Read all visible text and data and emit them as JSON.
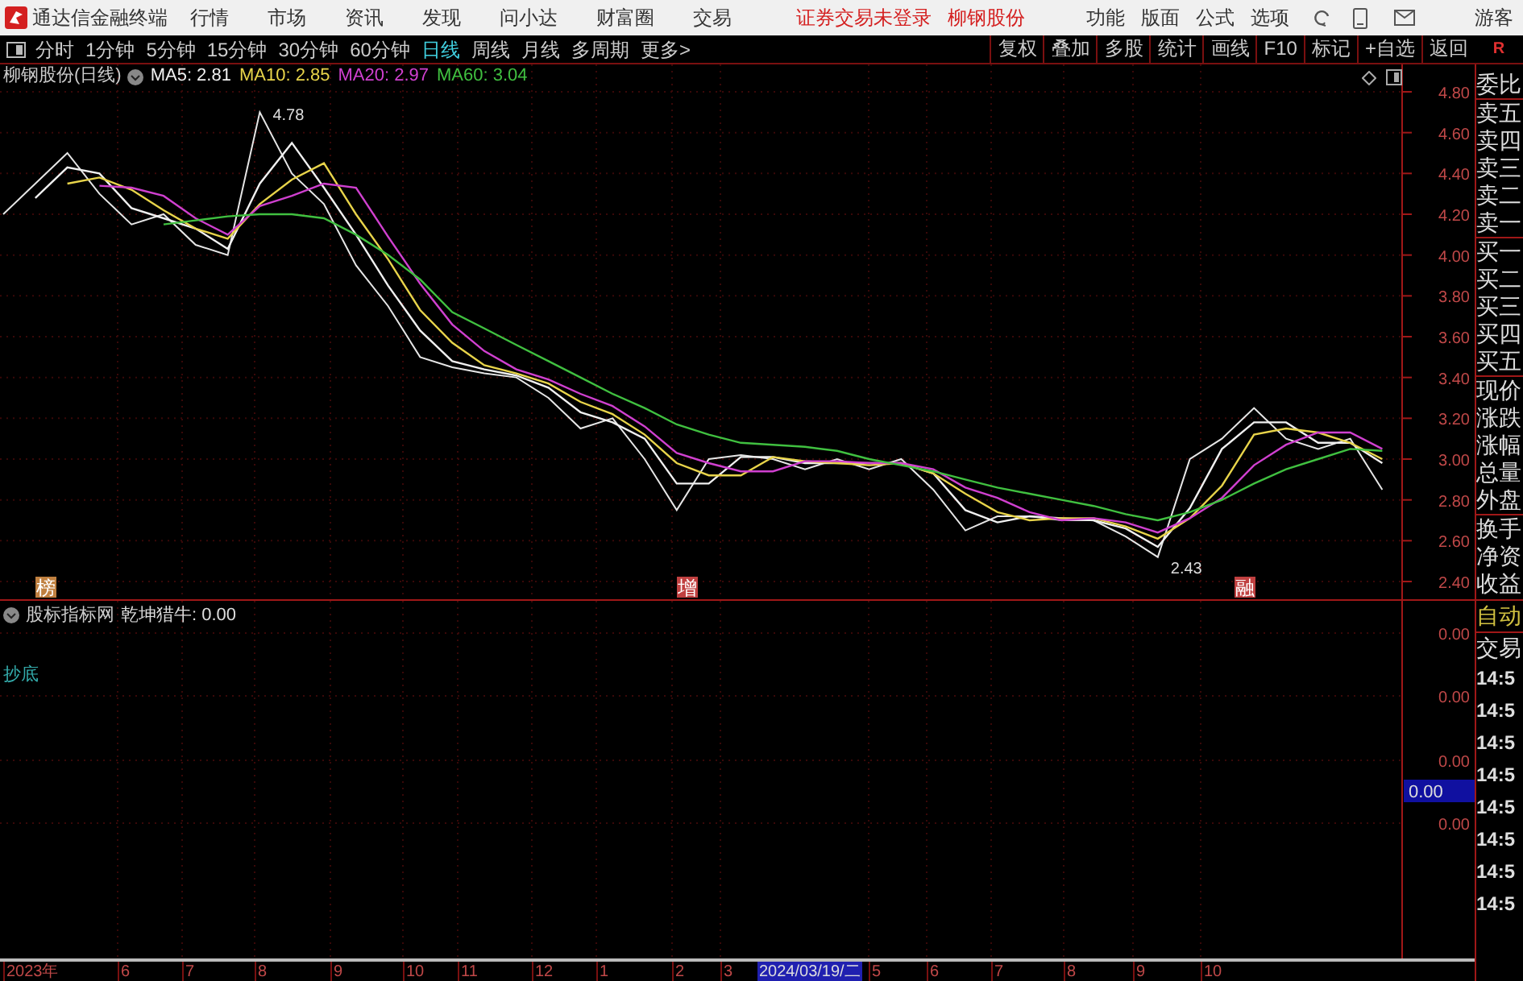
{
  "app": {
    "title": "通达信金融终端",
    "menu": [
      "行情",
      "市场",
      "资讯",
      "发现",
      "问小达",
      "财富圈",
      "交易"
    ],
    "notice": "证券交易未登录",
    "stock_link": "柳钢股份",
    "tools": [
      "功能",
      "版面",
      "公式",
      "选项"
    ],
    "user": "游客"
  },
  "periods": [
    {
      "label": "分时",
      "selected": false
    },
    {
      "label": "1分钟",
      "selected": false
    },
    {
      "label": "5分钟",
      "selected": false
    },
    {
      "label": "15分钟",
      "selected": false
    },
    {
      "label": "30分钟",
      "selected": false
    },
    {
      "label": "60分钟",
      "selected": false
    },
    {
      "label": "日线",
      "selected": true
    },
    {
      "label": "周线",
      "selected": false
    },
    {
      "label": "月线",
      "selected": false
    },
    {
      "label": "多周期",
      "selected": false
    },
    {
      "label": "更多>",
      "selected": false
    }
  ],
  "actions": [
    "复权",
    "叠加",
    "多股",
    "统计",
    "画线",
    "F10",
    "标记",
    "+自选",
    "返回"
  ],
  "corner_label": "R",
  "chart_title": "柳钢股份(日线)",
  "ma_values": [
    "2.81",
    "2.85",
    "2.97",
    "3.04"
  ],
  "chart_data": {
    "type": "line",
    "grid": true,
    "ylim": [
      2.4,
      4.8
    ],
    "yticks": [
      {
        "value": 4.8,
        "label": "4.80"
      },
      {
        "value": 4.6,
        "label": "4.60"
      },
      {
        "value": 4.4,
        "label": "4.40"
      },
      {
        "value": 4.2,
        "label": "4.20"
      },
      {
        "value": 4.0,
        "label": "4.00"
      },
      {
        "value": 3.8,
        "label": "3.80"
      },
      {
        "value": 3.6,
        "label": "3.60"
      },
      {
        "value": 3.4,
        "label": "3.40"
      },
      {
        "value": 3.2,
        "label": "3.20"
      },
      {
        "value": 3.0,
        "label": "3.00"
      },
      {
        "value": 2.8,
        "label": "2.80"
      },
      {
        "value": 2.6,
        "label": "2.60"
      },
      {
        "value": 2.4,
        "label": "2.40"
      }
    ],
    "series": [
      {
        "color": "#e6e6e6",
        "values": [
          4.2,
          4.35,
          4.5,
          4.3,
          4.15,
          4.2,
          4.05,
          4.0,
          4.7,
          4.4,
          4.25,
          3.95,
          3.75,
          3.5,
          3.45,
          3.42,
          3.4,
          3.3,
          3.15,
          3.2,
          3.0,
          2.75,
          3.0,
          3.02,
          3.0,
          2.95,
          3.0,
          2.95,
          3.0,
          2.85,
          2.65,
          2.72,
          2.72,
          2.7,
          2.7,
          2.62,
          2.52,
          3.0,
          3.1,
          3.25,
          3.1,
          3.05,
          3.1,
          2.85
        ]
      },
      {
        "name": "MA5:",
        "color": "#f0f0f0",
        "values": [
          null,
          4.28,
          4.43,
          4.4,
          4.23,
          4.18,
          4.13,
          4.03,
          4.35,
          4.55,
          4.33,
          4.1,
          3.85,
          3.63,
          3.48,
          3.44,
          3.41,
          3.35,
          3.23,
          3.18,
          3.1,
          2.88,
          2.88,
          3.01,
          3.01,
          2.98,
          2.98,
          2.98,
          2.98,
          2.93,
          2.75,
          2.69,
          2.72,
          2.71,
          2.7,
          2.66,
          2.57,
          2.76,
          3.05,
          3.18,
          3.18,
          3.08,
          3.08,
          2.98
        ]
      },
      {
        "name": "MA10:",
        "color": "#e8d44a",
        "values": [
          null,
          null,
          4.35,
          4.38,
          4.32,
          4.22,
          4.13,
          4.08,
          4.25,
          4.37,
          4.45,
          4.2,
          3.98,
          3.73,
          3.57,
          3.46,
          3.42,
          3.37,
          3.28,
          3.22,
          3.12,
          2.98,
          2.92,
          2.92,
          3.01,
          2.99,
          2.98,
          2.97,
          2.98,
          2.93,
          2.83,
          2.74,
          2.7,
          2.71,
          2.71,
          2.67,
          2.61,
          2.71,
          2.87,
          3.12,
          3.15,
          3.13,
          3.08,
          3.0
        ]
      },
      {
        "name": "MA20:",
        "color": "#d040d0",
        "values": [
          null,
          null,
          null,
          4.34,
          4.33,
          4.29,
          4.18,
          4.1,
          4.24,
          4.29,
          4.35,
          4.33,
          4.09,
          3.86,
          3.66,
          3.53,
          3.44,
          3.39,
          3.32,
          3.26,
          3.16,
          3.03,
          2.98,
          2.94,
          2.94,
          2.99,
          2.99,
          2.98,
          2.98,
          2.95,
          2.86,
          2.81,
          2.74,
          2.7,
          2.71,
          2.69,
          2.64,
          2.71,
          2.81,
          2.97,
          3.07,
          3.13,
          3.13,
          3.05
        ]
      },
      {
        "name": "MA60:",
        "color": "#40c040",
        "values": [
          null,
          null,
          null,
          null,
          null,
          4.15,
          4.17,
          4.19,
          4.2,
          4.2,
          4.18,
          4.1,
          4.0,
          3.88,
          3.72,
          3.64,
          3.56,
          3.48,
          3.4,
          3.32,
          3.25,
          3.17,
          3.12,
          3.08,
          3.07,
          3.06,
          3.04,
          3.0,
          2.97,
          2.94,
          2.9,
          2.86,
          2.83,
          2.8,
          2.77,
          2.73,
          2.7,
          2.74,
          2.8,
          2.88,
          2.95,
          3.0,
          3.05,
          3.04
        ]
      }
    ],
    "annotations": [
      "4.78",
      "2.43"
    ]
  },
  "event_marks": [
    {
      "text": "榜",
      "color": "#c08040"
    },
    {
      "text": "增",
      "color": "#c04040"
    },
    {
      "text": "融",
      "color": "#c04040"
    }
  ],
  "indicator": {
    "source": "股标指标网",
    "legend": "乾坤猎牛: 0.00",
    "signal": "抄底",
    "axis": [
      "0.00",
      "0.00",
      "0.00",
      "0.00"
    ],
    "cursor_value": "0.00"
  },
  "x_axis": [
    "2023年",
    "6",
    "7",
    "8",
    "9",
    "10",
    "11",
    "12",
    "1",
    "2",
    "3",
    "5",
    "6",
    "7",
    "8",
    "9",
    "10"
  ],
  "cursor_date": "2024/03/19/二",
  "quote_panel": [
    "委比",
    "卖五",
    "卖四",
    "卖三",
    "卖二",
    "卖一",
    "买一",
    "买二",
    "买三",
    "买四",
    "买五",
    "现价",
    "涨跌",
    "涨幅",
    "总量",
    "外盘",
    "换手",
    "净资",
    "收益"
  ],
  "trade_panel": {
    "mode": "自动",
    "label": "交易",
    "times": [
      "14:5",
      "14:5",
      "14:5",
      "14:5",
      "14:5",
      "14:5",
      "14:5",
      "14:5"
    ]
  }
}
